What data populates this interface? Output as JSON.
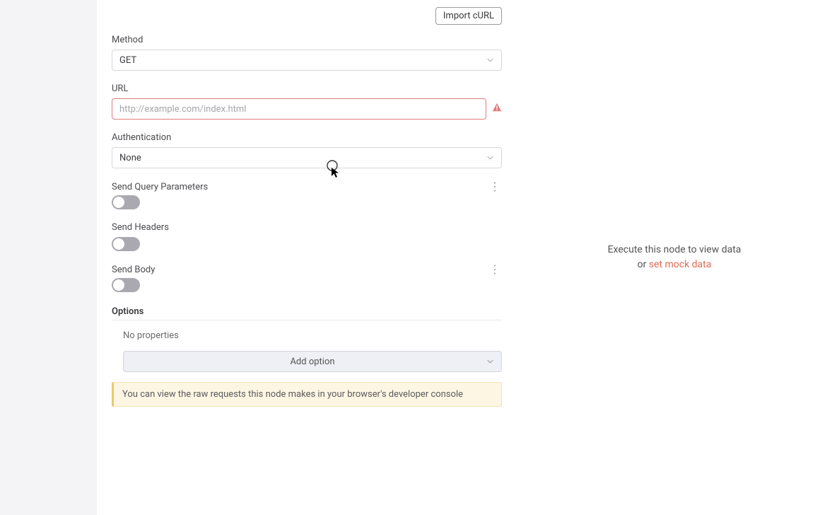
{
  "top": {
    "import_curl": "Import cURL"
  },
  "method": {
    "label": "Method",
    "value": "GET"
  },
  "url": {
    "label": "URL",
    "placeholder": "http://example.com/index.html",
    "value": ""
  },
  "auth": {
    "label": "Authentication",
    "value": "None"
  },
  "query": {
    "label": "Send Query Parameters"
  },
  "headers": {
    "label": "Send Headers"
  },
  "body": {
    "label": "Send Body"
  },
  "options": {
    "header": "Options",
    "no_props": "No properties",
    "add_option": "Add option"
  },
  "hint": "You can view the raw requests this node makes in your browser's developer console",
  "right": {
    "line1": "Execute this node to view data",
    "or": "or ",
    "link": "set mock data"
  }
}
